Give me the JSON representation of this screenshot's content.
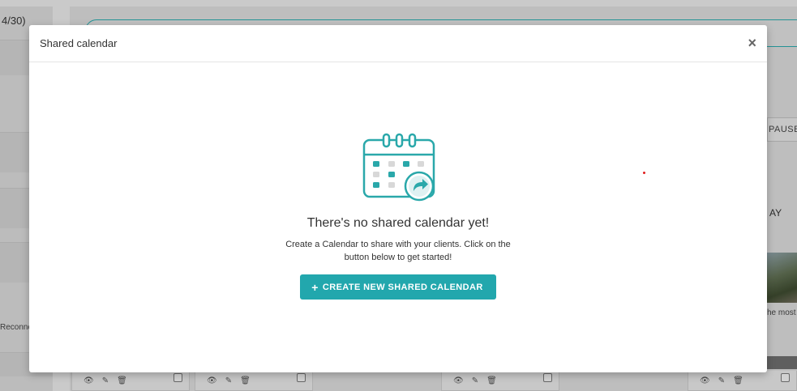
{
  "background": {
    "left_count": "4/30)",
    "left_status": "Reconnect",
    "right_button": "PAUSE",
    "right_heading": "AY",
    "right_caption": "he most",
    "footer_cards": [
      {
        "icons": [
          "eye-icon",
          "edit-icon",
          "trash-icon"
        ]
      },
      {
        "icons": [
          "eye-icon",
          "edit-icon",
          "trash-icon"
        ]
      },
      {
        "icons": [
          "eye-icon",
          "edit-icon",
          "trash-icon"
        ]
      },
      {
        "icons": [
          "eye-icon",
          "edit-icon",
          "trash-icon"
        ]
      }
    ]
  },
  "modal": {
    "title": "Shared calendar",
    "close_glyph": "×",
    "empty_title": "There's no shared calendar yet!",
    "empty_description": "Create a Calendar to share with your clients. Click on the button below to get started!",
    "button_plus": "+",
    "button_label": "CREATE NEW SHARED CALENDAR"
  },
  "colors": {
    "accent": "#22a7ad",
    "icon_teal": "#2aa8aa",
    "icon_grey": "#d8d8d8"
  }
}
